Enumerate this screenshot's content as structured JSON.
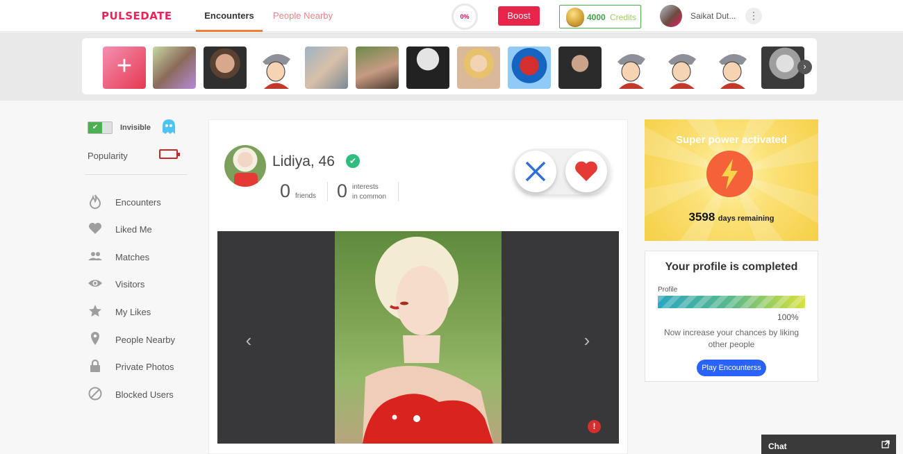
{
  "brand": {
    "logo": "PULSEDATE",
    "logo_color": "#f0205a"
  },
  "header": {
    "tabs": [
      {
        "label": "Encounters",
        "active": true
      },
      {
        "label": "People Nearby",
        "active": false
      }
    ],
    "profile_progress": "0%",
    "boost_label": "Boost",
    "credits_value": "4000",
    "credits_word": "Credits",
    "user_name": "Saikat Dut..."
  },
  "strip": {
    "add_label": "+",
    "thumbs": [
      "add-photo",
      "person-glasses",
      "man-beard",
      "cartoon-avatar",
      "couple-selfie",
      "man-sitting",
      "man-suit",
      "woman-blonde",
      "spiderman",
      "man-dark",
      "cartoon-avatar",
      "cartoon-avatar",
      "cartoon-avatar",
      "woman-bw"
    ]
  },
  "sidebar": {
    "invisible_label": "Invisible",
    "invisible_on": true,
    "popularity_label": "Popularity",
    "items": [
      {
        "label": "Encounters",
        "icon": "flame-icon"
      },
      {
        "label": "Liked Me",
        "icon": "heart-icon"
      },
      {
        "label": "Matches",
        "icon": "people-icon"
      },
      {
        "label": "Visitors",
        "icon": "eye-icon"
      },
      {
        "label": "My Likes",
        "icon": "star-icon"
      },
      {
        "label": "People Nearby",
        "icon": "location-icon"
      },
      {
        "label": "Private Photos",
        "icon": "lock-icon"
      },
      {
        "label": "Blocked Users",
        "icon": "block-icon"
      }
    ]
  },
  "profile": {
    "name": "Lidiya, 46",
    "friends_count": "0",
    "friends_label": "friends",
    "interests_count": "0",
    "interests_label_1": "interests",
    "interests_label_2": "in common"
  },
  "superpower": {
    "title": "Super power activated",
    "days": "3598",
    "days_label": "days remaining"
  },
  "profile_complete": {
    "title": "Your profile is completed",
    "bar_label": "Profile",
    "percent": "100%",
    "message": "Now increase your chances by liking other people",
    "button": "Play Encounterss"
  },
  "chat": {
    "label": "Chat"
  },
  "colors": {
    "accent": "#e8264c",
    "tab_underline": "#f27c3a",
    "credits": "#43a047",
    "verified": "#2ebd7c"
  }
}
